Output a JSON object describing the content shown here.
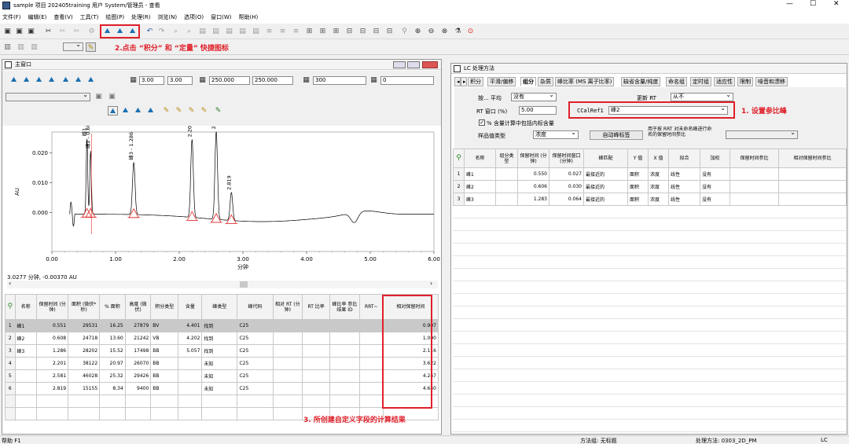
{
  "window": {
    "title": "sample 项目 202405training 用户 System/管理员 - 查看",
    "controls": [
      "—",
      "☐",
      "✕"
    ]
  },
  "menu": [
    "文件(F)",
    "编辑(E)",
    "查看(V)",
    "工具(T)",
    "绘图(P)",
    "处理(R)",
    "浏览(N)",
    "选项(O)",
    "窗口(W)",
    "帮助(H)"
  ],
  "annotations": {
    "step1": "1. 设置参比峰",
    "step2": "2.点击 “积分” 和 “定量” 快捷图标",
    "step3": "3. 所创建自定义字段的计算结果"
  },
  "main_window": {
    "title": "主窗口",
    "zoom_values": [
      "3.00",
      "3.00",
      "250.000",
      "250.000",
      "300",
      "0"
    ],
    "cursor_readout": "3.0277 分钟, -0.00370 AU"
  },
  "chart_data": {
    "type": "line",
    "xlabel": "分钟",
    "ylabel": "AU",
    "xlim": [
      0.0,
      6.0
    ],
    "ylim": [
      -0.013,
      0.027
    ],
    "xticks": [
      "0.00",
      "1.00",
      "2.00",
      "3.00",
      "4.00",
      "5.00",
      "6.00"
    ],
    "yticks": [
      "0.000",
      "0.010",
      "0.020"
    ],
    "peaks": [
      {
        "rt": 0.551,
        "height": 0.0253,
        "label": "峰1 - 0.551"
      },
      {
        "rt": 0.608,
        "height": 0.0212,
        "label": "峰2 - 0.608"
      },
      {
        "rt": 1.286,
        "height": 0.0175,
        "label": "峰3 - 1.286"
      },
      {
        "rt": 2.201,
        "height": 0.0261,
        "label": "2.201"
      },
      {
        "rt": 2.581,
        "height": 0.0294,
        "label": "2.581"
      },
      {
        "rt": 2.819,
        "height": 0.0094,
        "label": "2.819"
      }
    ]
  },
  "peak_table": {
    "headers": [
      "名称",
      "保留时间 (分钟)",
      "面积 (微伏*秒)",
      "% 面积",
      "高度 (微伏)",
      "积分类型",
      "含量",
      "峰类型",
      "峰代码",
      "相对 RT (分钟)",
      "RT 比率",
      "峰比率 参比 结果 ID",
      "RRT~",
      "相对保留时间"
    ],
    "rows": [
      [
        "峰1",
        "0.551",
        "29531",
        "16.25",
        "27879",
        "BV",
        "4.401",
        "找到",
        "C25",
        "",
        "",
        "",
        "",
        "0.907"
      ],
      [
        "峰2",
        "0.608",
        "24718",
        "13.60",
        "21242",
        "VB",
        "4.202",
        "找到",
        "C25",
        "",
        "",
        "",
        "",
        "1.000"
      ],
      [
        "峰3",
        "1.286",
        "28202",
        "15.52",
        "17498",
        "BB",
        "5.057",
        "找到",
        "C25",
        "",
        "",
        "",
        "",
        "2.116"
      ],
      [
        "",
        "2.201",
        "38122",
        "20.97",
        "26070",
        "BB",
        "",
        "未知",
        "C25",
        "",
        "",
        "",
        "",
        "3.622"
      ],
      [
        "",
        "2.581",
        "46028",
        "25.32",
        "29426",
        "BB",
        "",
        "未知",
        "C25",
        "",
        "",
        "",
        "",
        "4.247"
      ],
      [
        "",
        "2.819",
        "15155",
        "8.34",
        "9400",
        "BB",
        "",
        "未知",
        "C25",
        "",
        "",
        "",
        "",
        "4.640"
      ]
    ]
  },
  "lc_method": {
    "title": "LC 处理方法",
    "tabs": [
      "积分",
      "平滑/偏移",
      "组分",
      "杂质",
      "峰比率 (MS 离子比率)",
      "缺省含量/纯度",
      "命名组",
      "定时组",
      "适应性",
      "限制",
      "噪音和漂移"
    ],
    "active_tab": "组分",
    "fields": {
      "avg_label": "按... 平均",
      "avg_value": "没有",
      "update_rt_label": "更新 RT",
      "update_rt_value": "从不",
      "rt_window_label": "RT 窗口 (%)",
      "rt_window_value": "5.00",
      "ref_label": "CCalRef1",
      "ref_value": "峰2",
      "checkbox_label": "% 含量计算中包括内标含量",
      "sample_type_label": "样品值类型",
      "sample_type_value": "浓度",
      "auto_btn": "自动峰标签",
      "named_peaks_label": "用于按 RRT 对未命名峰进行命名的保留时间参比"
    },
    "headers": [
      "名称",
      "组分类型",
      "保留时间 (分钟)",
      "保留时间窗口 (分钟)",
      "峰匹配",
      "Y 值",
      "X 值",
      "拟合",
      "加权",
      "保留时间参比",
      "相对保留时间参比"
    ],
    "rows": [
      [
        "峰1",
        "",
        "0.550",
        "0.027",
        "最接近的",
        "面积",
        "浓度",
        "线性",
        "没有",
        "",
        ""
      ],
      [
        "峰2",
        "",
        "0.606",
        "0.030",
        "最接近的",
        "面积",
        "浓度",
        "线性",
        "没有",
        "",
        ""
      ],
      [
        "峰3",
        "",
        "1.283",
        "0.064",
        "最接近的",
        "面积",
        "浓度",
        "线性",
        "没有",
        "",
        ""
      ]
    ]
  },
  "status": {
    "help": "帮助 F1",
    "method_group": "方法组: 无标题",
    "proc_method": "处理方法: 0303_2D_PM",
    "mode": "LC"
  }
}
